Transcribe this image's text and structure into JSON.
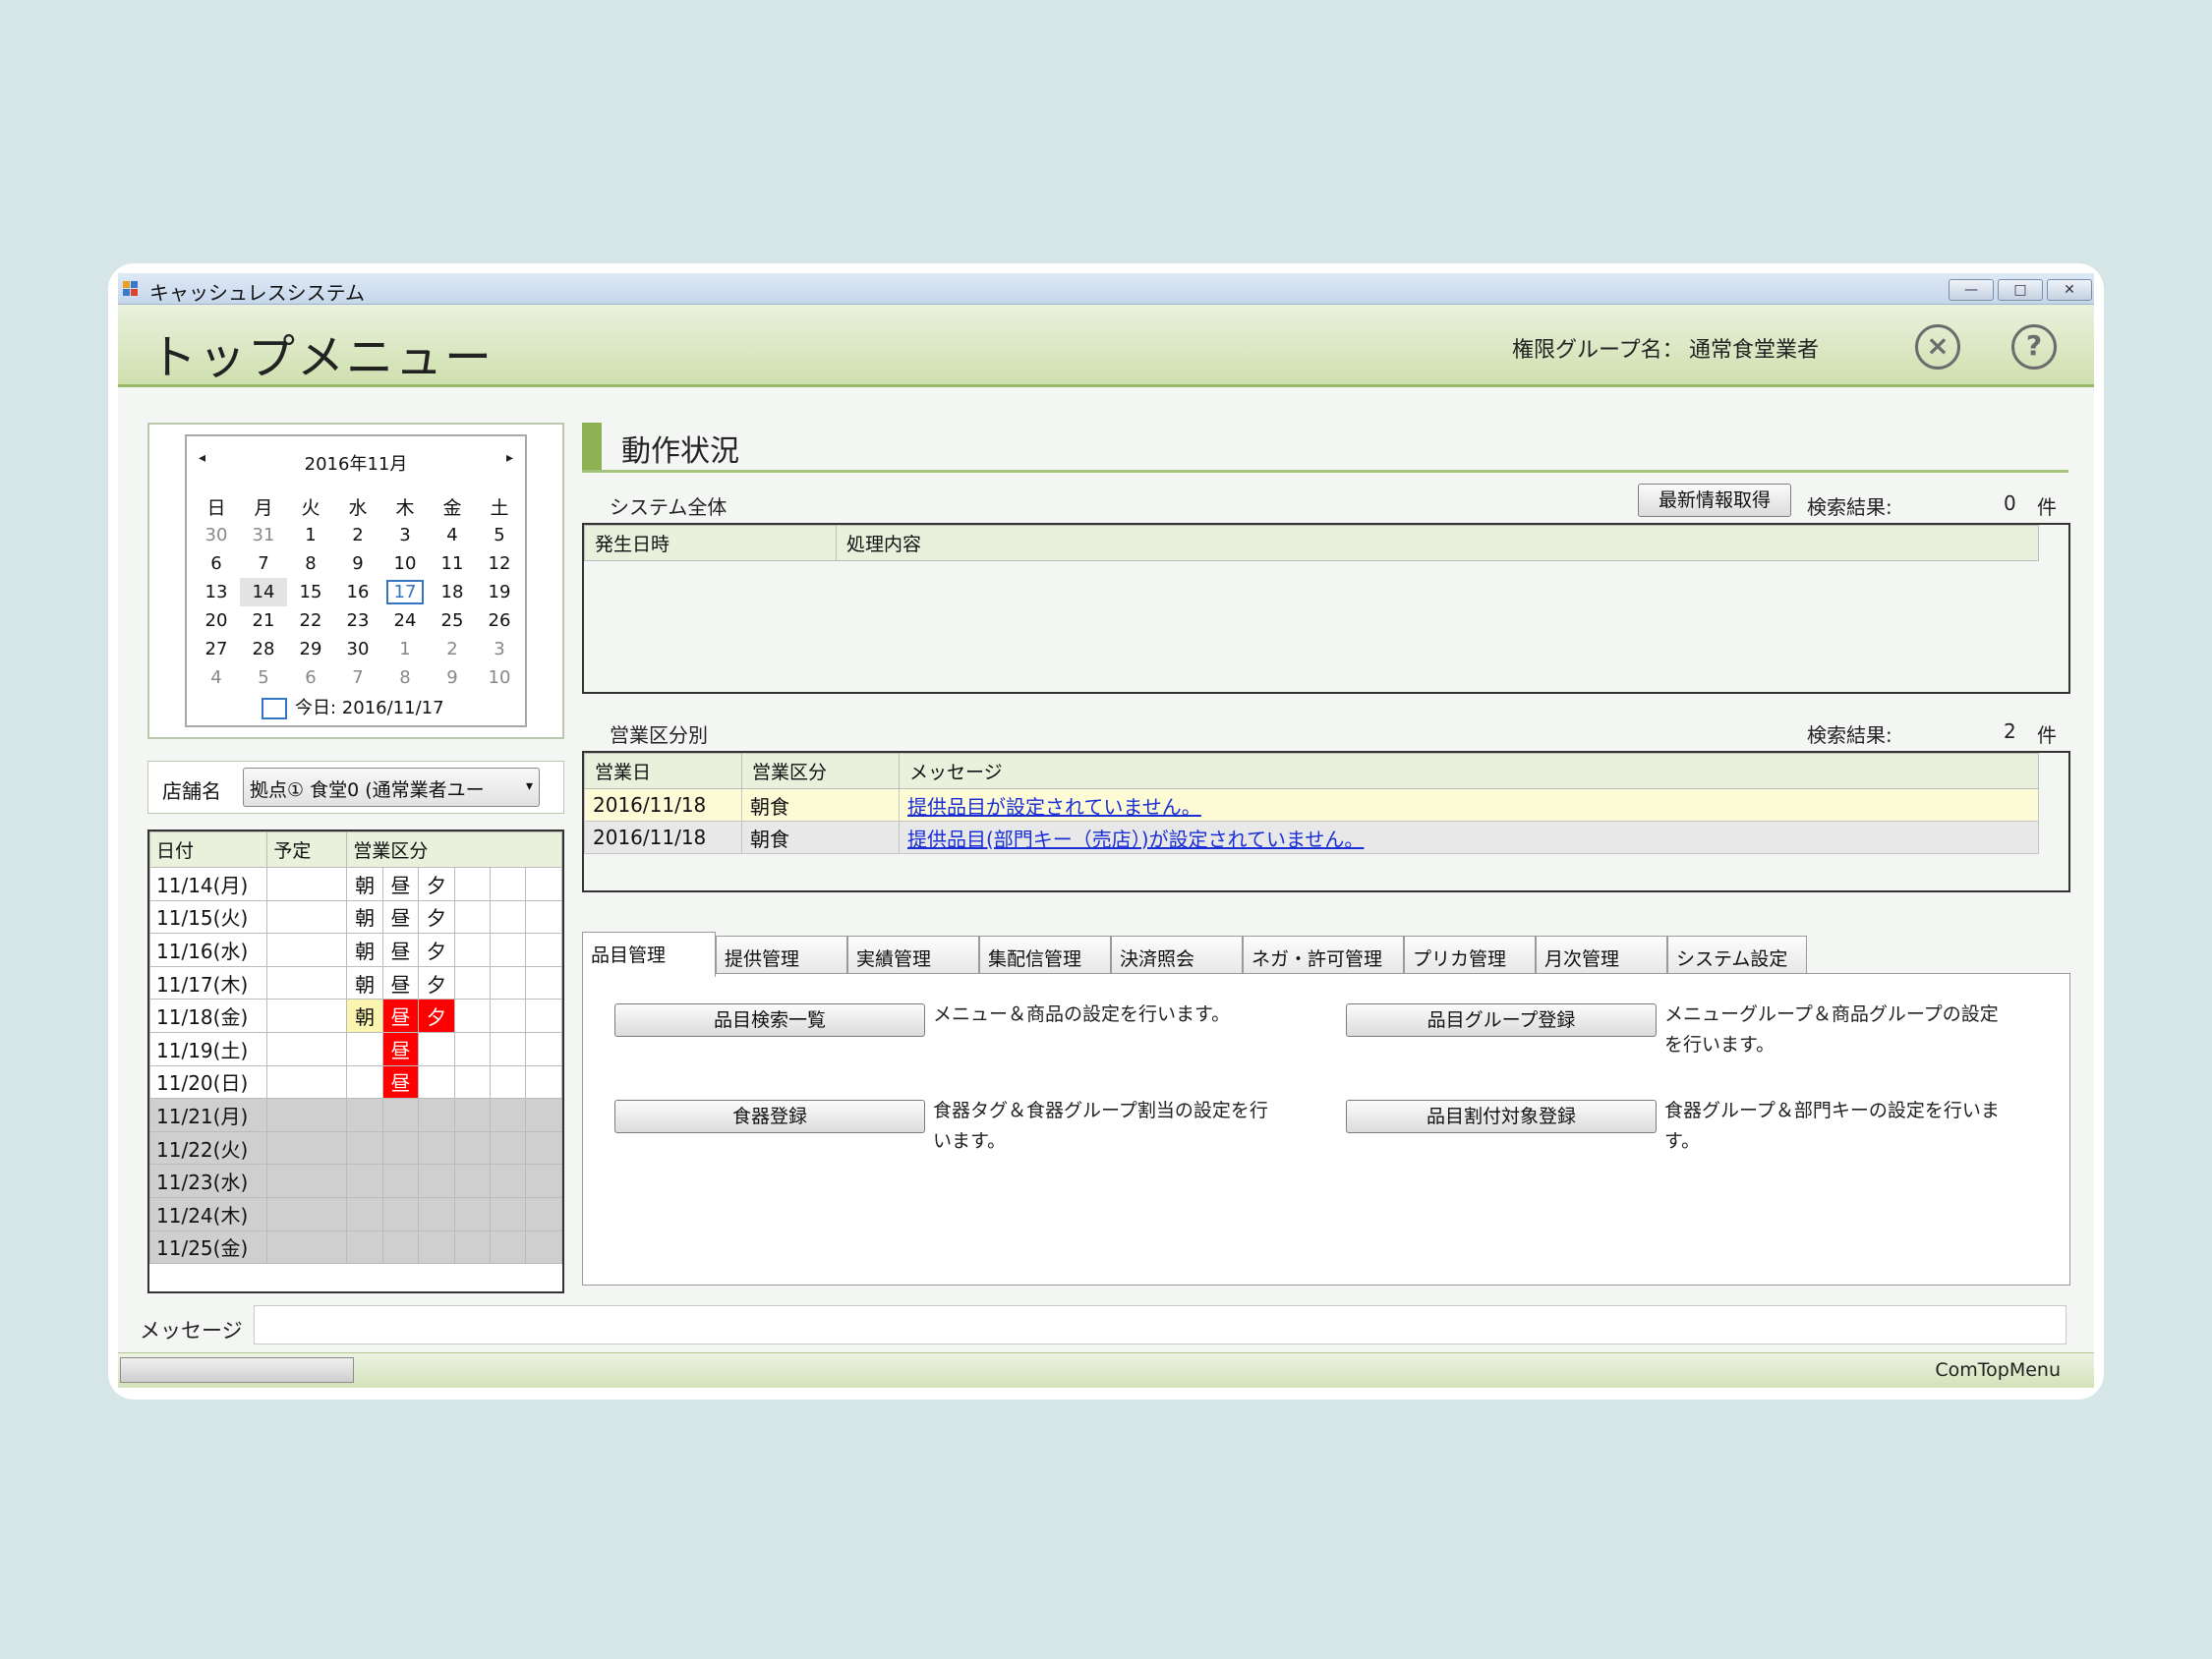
{
  "window": {
    "title": "キャッシュレスシステム",
    "minimize": "—",
    "maximize": "□",
    "close": "✕"
  },
  "header": {
    "title": "トップメニュー",
    "perm_label": "権限グループ名：",
    "perm_value": "通常食堂業者",
    "close_icon": "×",
    "help_icon": "?"
  },
  "calendar": {
    "prev": "◂",
    "next": "▸",
    "month": "2016年11月",
    "weekdays": [
      "日",
      "月",
      "火",
      "水",
      "木",
      "金",
      "土"
    ],
    "weeks": [
      [
        "30",
        "31",
        "1",
        "2",
        "3",
        "4",
        "5"
      ],
      [
        "6",
        "7",
        "8",
        "9",
        "10",
        "11",
        "12"
      ],
      [
        "13",
        "14",
        "15",
        "16",
        "17",
        "18",
        "19"
      ],
      [
        "20",
        "21",
        "22",
        "23",
        "24",
        "25",
        "26"
      ],
      [
        "27",
        "28",
        "29",
        "30",
        "1",
        "2",
        "3"
      ],
      [
        "4",
        "5",
        "6",
        "7",
        "8",
        "9",
        "10"
      ]
    ],
    "today": "今日: 2016/11/17"
  },
  "store": {
    "label": "店舗名",
    "value": "拠点① 食堂0 (通常業者ユー",
    "arrow": "▾"
  },
  "schedule": {
    "headers": {
      "date": "日付",
      "plan": "予定",
      "section": "営業区分"
    },
    "rows": [
      {
        "date": "11/14(月)",
        "s1": "朝",
        "s2": "昼",
        "s3": "夕"
      },
      {
        "date": "11/15(火)",
        "s1": "朝",
        "s2": "昼",
        "s3": "夕"
      },
      {
        "date": "11/16(水)",
        "s1": "朝",
        "s2": "昼",
        "s3": "夕"
      },
      {
        "date": "11/17(木)",
        "s1": "朝",
        "s2": "昼",
        "s3": "夕"
      },
      {
        "date": "11/18(金)",
        "s1": "朝",
        "s2": "昼",
        "s3": "夕"
      },
      {
        "date": "11/19(土)",
        "s1": "",
        "s2": "昼",
        "s3": ""
      },
      {
        "date": "11/20(日)",
        "s1": "",
        "s2": "昼",
        "s3": ""
      },
      {
        "date": "11/21(月)"
      },
      {
        "date": "11/22(火)"
      },
      {
        "date": "11/23(水)"
      },
      {
        "date": "11/24(木)"
      },
      {
        "date": "11/25(金)"
      }
    ]
  },
  "status": {
    "title": "動作状況",
    "system": {
      "label": "システム全体",
      "refresh_button": "最新情報取得",
      "result_label": "検索結果:",
      "result_count": "0",
      "unit": "件",
      "col1": "発生日時",
      "col2": "処理内容"
    },
    "business": {
      "label": "営業区分別",
      "result_label": "検索結果:",
      "result_count": "2",
      "unit": "件",
      "col1": "営業日",
      "col2": "営業区分",
      "col3": "メッセージ",
      "rows": [
        {
          "date": "2016/11/18",
          "section": "朝食",
          "message": "提供品目が設定されていません。"
        },
        {
          "date": "2016/11/18",
          "section": "朝食",
          "message": "提供品目(部門キー（売店）)が設定されていません。"
        }
      ]
    }
  },
  "tabs": [
    "品目管理",
    "提供管理",
    "実績管理",
    "集配信管理",
    "決済照会",
    "ネガ・許可管理",
    "プリカ管理",
    "月次管理",
    "システム設定"
  ],
  "panel": {
    "btn1": "品目検索一覧",
    "desc1": "メニュー＆商品の設定を行います。",
    "btn2": "品目グループ登録",
    "desc2a": "メニューグループ＆商品グループの設定",
    "desc2b": "を行います。",
    "btn3": "食器登録",
    "desc3a": "食器タグ＆食器グループ割当の設定を行",
    "desc3b": "います。",
    "btn4": "品目割付対象登録",
    "desc4a": "食器グループ＆部門キーの設定を行いま",
    "desc4b": "す。"
  },
  "footer": {
    "message_label": "メッセージ",
    "message_value": "",
    "status_text": "ComTopMenu"
  },
  "colors": {
    "accent_green": "#8db253",
    "alert_red": "#ff0000",
    "highlight_yellow": "#fbf5b0",
    "link_blue": "#1a2ed6"
  }
}
